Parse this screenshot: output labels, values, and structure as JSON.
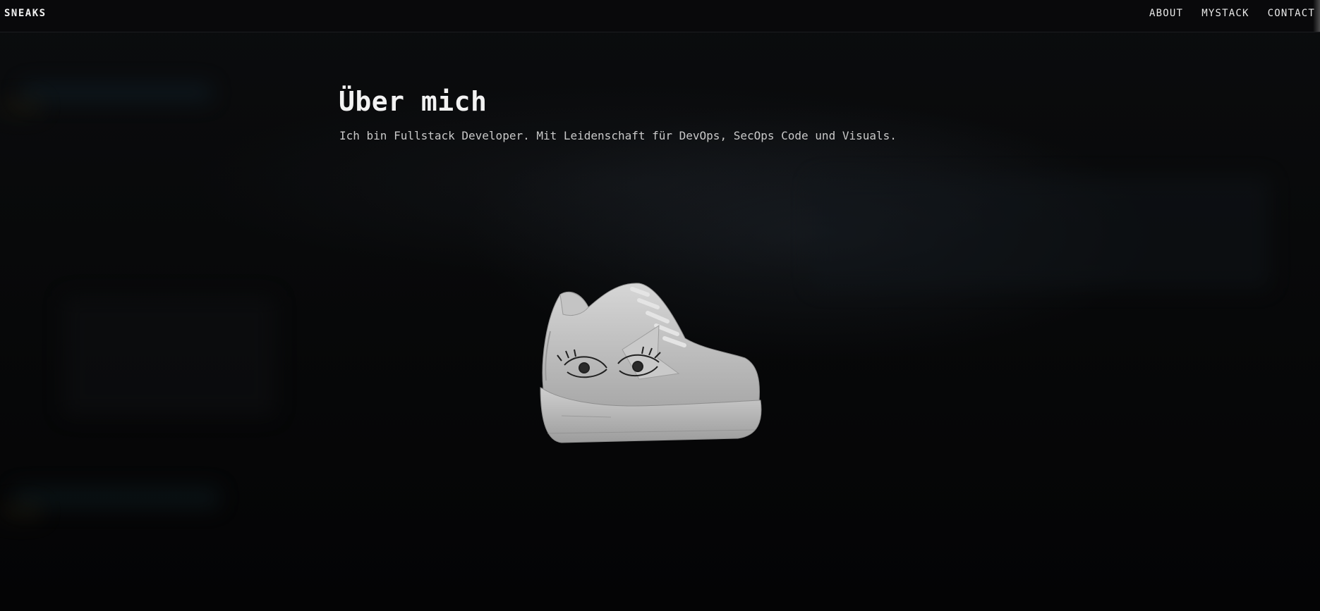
{
  "header": {
    "brand": "SNEAKS",
    "nav": [
      {
        "label": "ABOUT"
      },
      {
        "label": "MYSTACK"
      },
      {
        "label": "CONTACT"
      }
    ]
  },
  "about": {
    "title": "Über mich",
    "text": "Ich bin Fullstack Developer. Mit Leidenschaft für DevOps, SecOps Code und Visuals."
  },
  "visual": {
    "icon": "sneaker-3d-model",
    "colors": {
      "background": "#050506",
      "text": "#f2f2f2",
      "subtext": "#c9c9c9",
      "shoe": "#bdbdbd"
    }
  }
}
